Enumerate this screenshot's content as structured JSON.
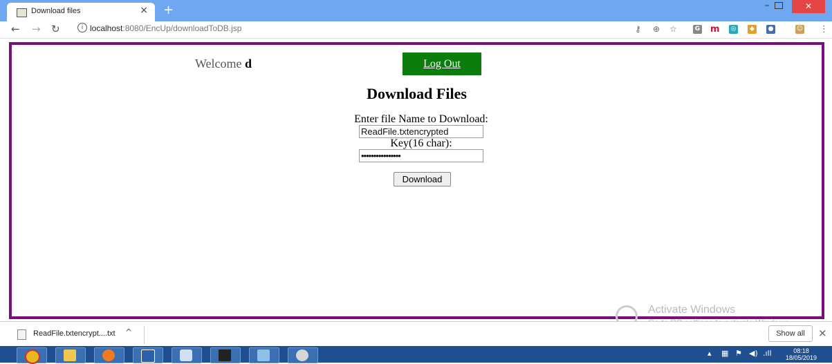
{
  "browser": {
    "tab_title": "Download files",
    "tab_close": "×",
    "new_tab": "+",
    "url_host": "localhost",
    "url_path": ":8080/EncUp/downloadToDB.jsp"
  },
  "page": {
    "welcome_prefix": "Welcome",
    "username": "d",
    "logout_label": "Log Out",
    "title": "Download Files",
    "file_label": "Enter file Name to Download:",
    "file_value": "ReadFile.txtencrypted",
    "key_label": "Key(16 char):",
    "key_value": "••••••••••••••••",
    "download_label": "Download"
  },
  "watermark": {
    "title": "Activate Windows",
    "subtitle": "Go to PC settings to activate Windows."
  },
  "downloads_bar": {
    "file_name": "ReadFile.txtencrypt....txt",
    "caret": "^",
    "show_all": "Show all",
    "close": "×"
  },
  "taskbar": {
    "time": "08:18",
    "date": "18/05/2019"
  },
  "colors": {
    "frame_border": "#7a0e7e",
    "logout_bg": "#0c7d0c",
    "tabstrip": "#6fa8f0",
    "taskbar": "#1f4f8e"
  }
}
